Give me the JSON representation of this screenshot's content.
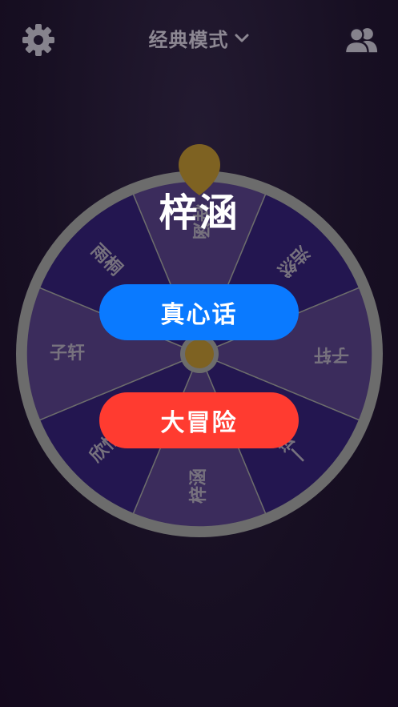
{
  "header": {
    "mode_label": "经典模式",
    "left_icon": "gear-icon",
    "right_icon": "users-icon",
    "mode_dropdown_icon": "chevron-down-icon"
  },
  "wheel": {
    "selected_name": "梓涵",
    "segments": [
      "梓涵",
      "浩然",
      "子轩",
      "一诺",
      "梓涵",
      "欣怡",
      "子轩",
      "雨桐"
    ]
  },
  "actions": {
    "truth_label": "真心话",
    "dare_label": "大冒险"
  },
  "colors": {
    "segment_light": "#3b2c5c",
    "segment_dark": "#231650",
    "rim": "#6c6c6c",
    "pointer": "#7e6222",
    "truth": "#0a7aff",
    "dare": "#ff3b30"
  }
}
